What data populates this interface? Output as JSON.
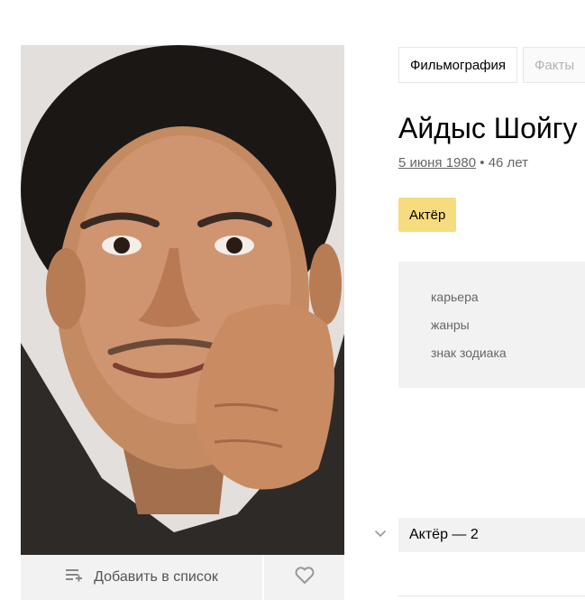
{
  "tabs": [
    {
      "label": "Фильмография",
      "active": true
    },
    {
      "label": "Факты",
      "active": false
    }
  ],
  "person": {
    "name": "Айдыс Шойгу",
    "birth_date": "5 июня 1980",
    "age_sep": " • ",
    "age": "46 лет"
  },
  "role_badge": "Актёр",
  "info": {
    "items": [
      "карьера",
      "жанры",
      "знак зодиака"
    ]
  },
  "actions": {
    "add_to_list": "Добавить в список",
    "add_icon": "add-to-list-icon",
    "favorite_icon": "heart-icon"
  },
  "filmography": {
    "section_label": "Актёр — 2",
    "toggle_icon": "chevron-down-icon"
  },
  "colors": {
    "badge": "#f7db7f",
    "panel": "#f2f2f2",
    "muted_text": "#666666"
  }
}
